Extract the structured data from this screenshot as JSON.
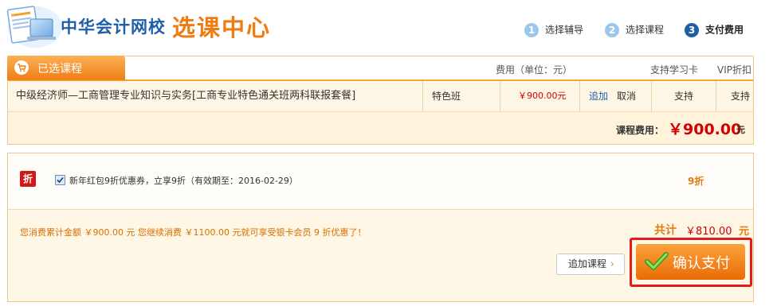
{
  "header": {
    "brand": "中华会计网校",
    "subtitle": "选课中心",
    "steps": [
      {
        "num": "1",
        "label": "选择辅导"
      },
      {
        "num": "2",
        "label": "选择课程"
      },
      {
        "num": "3",
        "label": "支付费用"
      }
    ],
    "active_step": "3"
  },
  "course_box": {
    "tab_label": "已选课程",
    "tab_icon": "cart-icon",
    "col_fee": "费用（单位：元）",
    "col_card": "支持学习卡",
    "col_vip": "VIP折扣",
    "course": {
      "name": "中级经济师—工商管理专业知识与实务[工商专业特色通关班两科联报套餐]",
      "type": "特色班",
      "price": "￥900.00元",
      "add_label": "追加",
      "cancel_label": "取消",
      "card_support": "支持",
      "vip_support": "支持"
    },
    "fee_label": "课程费用：",
    "fee_value": "￥900.00",
    "fee_unit": "元"
  },
  "discount_box": {
    "badge": "折",
    "coupon_checked": true,
    "coupon_text": "新年红包9折优惠券，立享9折（有效期至：2016-02-29）",
    "coupon_rate": "9折",
    "promo_text": "您消费累计金额 ￥900.00 元 您继续消费 ￥1100.00 元就可享受银卡会员 9 折优惠了！",
    "total_label": "共计",
    "total_value": "￥810.00",
    "total_unit": "元",
    "add_course_label": "追加课程",
    "add_course_arrow": "›",
    "confirm_label": "确认支付"
  },
  "colors": {
    "brand_blue": "#1f5fa8",
    "accent_orange": "#f07b10",
    "price_red": "#d40000",
    "highlight_red": "#e41b1b"
  }
}
